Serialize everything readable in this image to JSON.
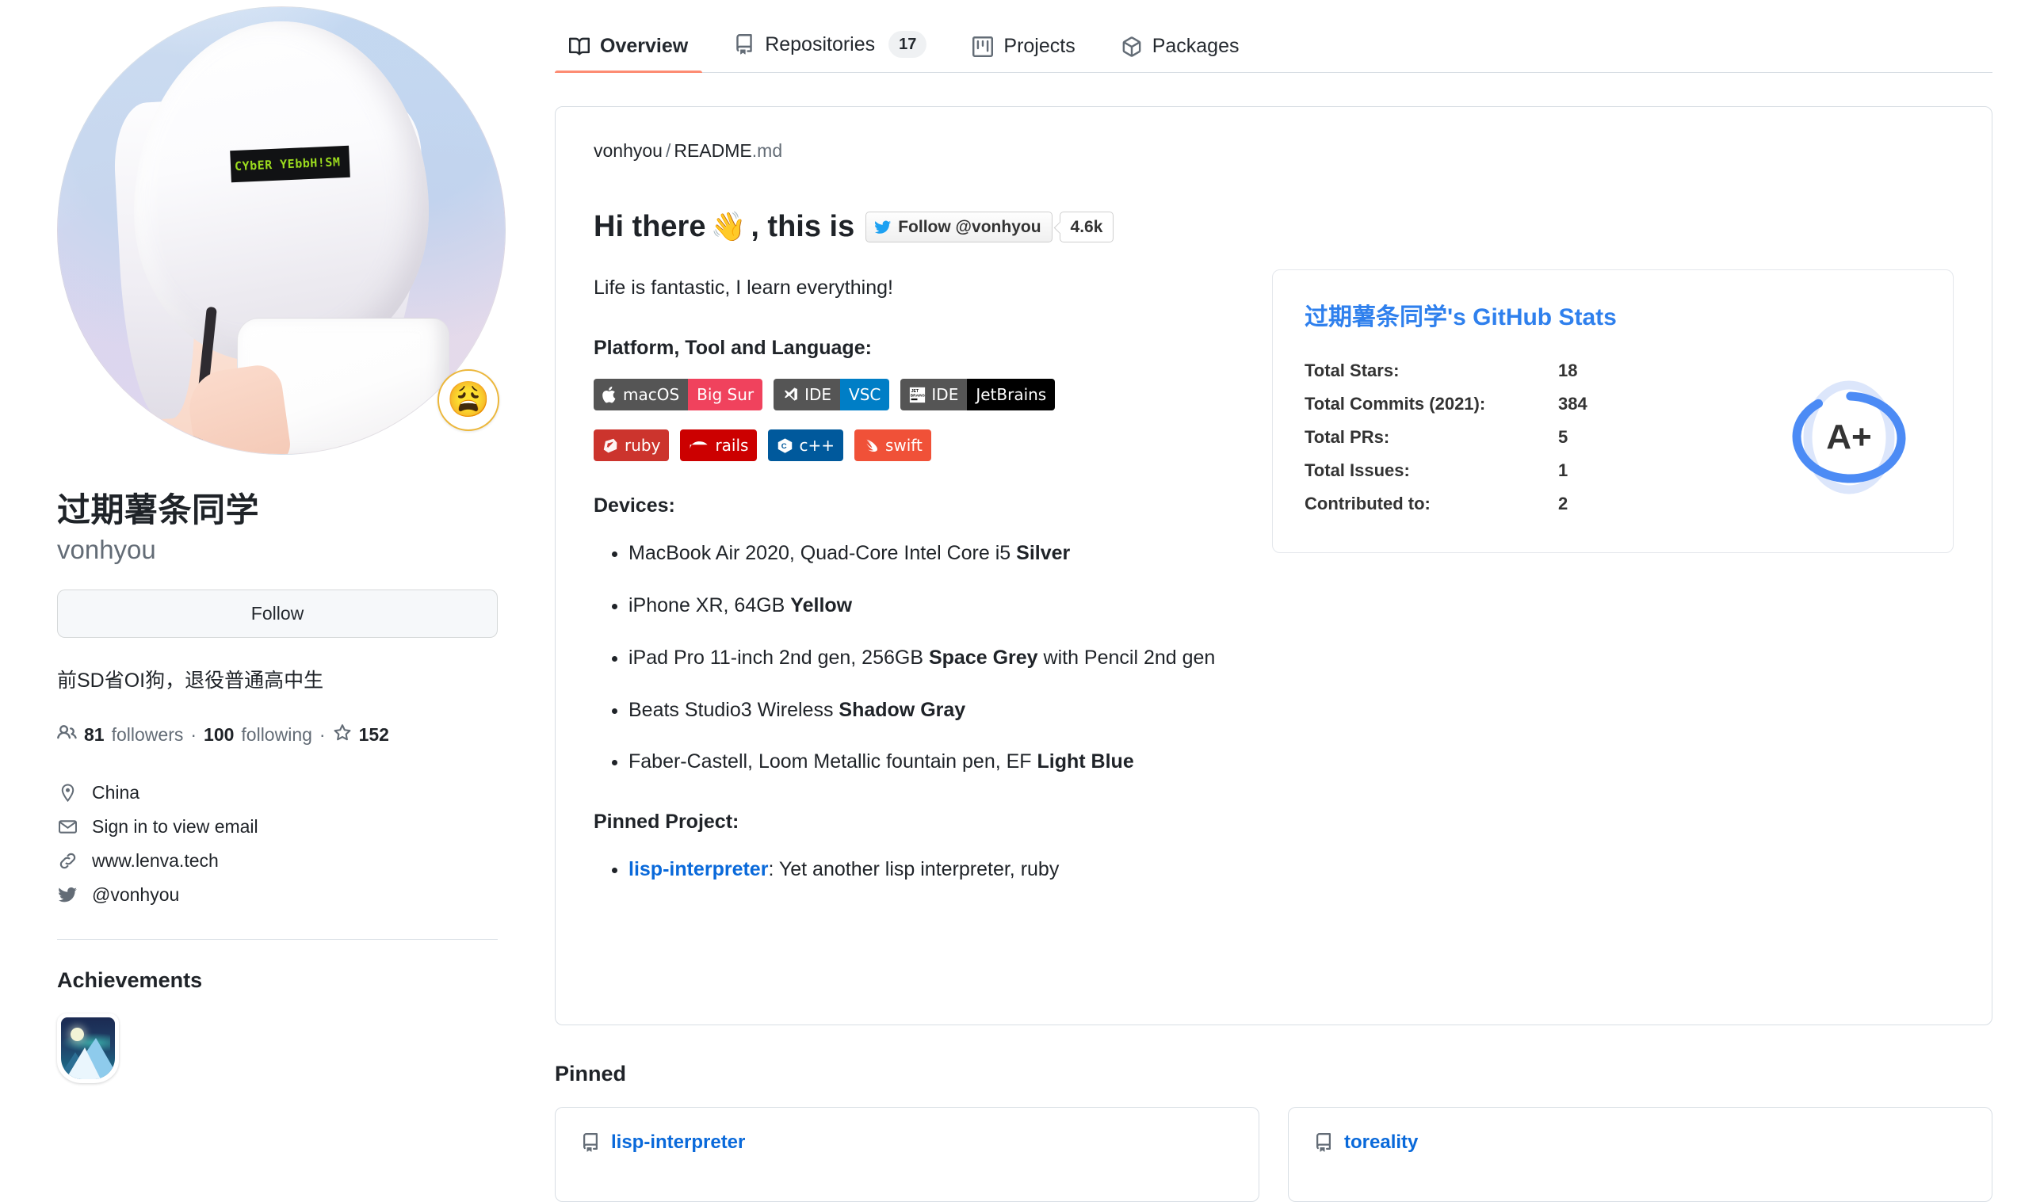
{
  "tabs": [
    {
      "label": "Overview",
      "icon": "book-icon",
      "active": true,
      "count": null
    },
    {
      "label": "Repositories",
      "icon": "repo-icon",
      "active": false,
      "count": "17"
    },
    {
      "label": "Projects",
      "icon": "project-icon",
      "active": false,
      "count": null
    },
    {
      "label": "Packages",
      "icon": "package-icon",
      "active": false,
      "count": null
    }
  ],
  "profile": {
    "display_name": "过期薯条同学",
    "login": "vonhyou",
    "follow_label": "Follow",
    "bio": "前SD省OI狗，退役普通高中生",
    "status_emoji": "😩",
    "avatar_censor_text": "CYbER YEbbH!SM",
    "stats": {
      "followers_count": "81",
      "followers_label": "followers",
      "following_count": "100",
      "following_label": "following",
      "stars_count": "152",
      "separator": "·"
    },
    "meta": [
      {
        "icon": "location-icon",
        "text": "China"
      },
      {
        "icon": "mail-icon",
        "text": "Sign in to view email"
      },
      {
        "icon": "link-icon",
        "text": "www.lenva.tech"
      },
      {
        "icon": "twitter-icon",
        "text": "@vonhyou"
      }
    ],
    "achievements_title": "Achievements",
    "achievement_badge_name": "arctic-code-vault-badge"
  },
  "readme": {
    "breadcrumb_owner": "vonhyou",
    "breadcrumb_slash": "/",
    "breadcrumb_file": "README",
    "breadcrumb_ext": ".md",
    "heading_pre": "Hi there",
    "heading_wave": "👋",
    "heading_post": ", this is",
    "twitter_follow_label": "Follow @vonhyou",
    "twitter_count": "4.6k",
    "intro": "Life is fantastic, I learn everything!",
    "platform_heading": "Platform, Tool and Language:",
    "platform_badges": [
      {
        "left": "macOS",
        "right": "Big Sur",
        "icon": "apple-icon",
        "left_color": "#555555",
        "right_color": "#F0425D"
      },
      {
        "left": "IDE",
        "right": "VSC",
        "icon": "vscode-icon",
        "left_color": "#555555",
        "right_color": "#007EC6"
      },
      {
        "left": "IDE",
        "right": "JetBrains",
        "icon": "jetbrains-icon",
        "left_color": "#555555",
        "right_color": "#000000"
      }
    ],
    "language_badges": [
      {
        "label": "ruby",
        "icon": "ruby-icon",
        "color": "#CC342D"
      },
      {
        "label": "rails",
        "icon": "rails-icon",
        "color": "#CC0000"
      },
      {
        "label": "c++",
        "icon": "cpp-icon",
        "color": "#00599C"
      },
      {
        "label": "swift",
        "icon": "swift-icon",
        "color": "#F05138"
      }
    ],
    "devices_heading": "Devices:",
    "devices": [
      {
        "text": "MacBook Air 2020, Quad-Core Intel Core i5 ",
        "bold": "Silver",
        "after": ""
      },
      {
        "text": "iPhone XR, 64GB ",
        "bold": "Yellow",
        "after": ""
      },
      {
        "text": "iPad Pro 11-inch 2nd gen, 256GB ",
        "bold": "Space Grey",
        "after": " with Pencil 2nd gen"
      },
      {
        "text": "Beats Studio3 Wireless ",
        "bold": "Shadow Gray",
        "after": ""
      },
      {
        "text": "Faber-Castell, Loom Metallic fountain pen, EF ",
        "bold": "Light Blue",
        "after": ""
      }
    ],
    "pinned_project_heading": "Pinned Project:",
    "pinned_project_link": "lisp-interpreter",
    "pinned_project_desc": ": Yet another lisp interpreter, ruby"
  },
  "github_stats": {
    "title": "过期薯条同学's GitHub Stats",
    "rank": "A+",
    "rank_accent": "#4c8bf5",
    "rank_track": "#dce6fb",
    "rows": [
      {
        "label": "Total Stars:",
        "value": "18"
      },
      {
        "label": "Total Commits (2021):",
        "value": "384"
      },
      {
        "label": "Total PRs:",
        "value": "5"
      },
      {
        "label": "Total Issues:",
        "value": "1"
      },
      {
        "label": "Contributed to:",
        "value": "2"
      }
    ]
  },
  "pinned": {
    "title": "Pinned",
    "repos": [
      {
        "name": "lisp-interpreter"
      },
      {
        "name": "toreality"
      }
    ]
  }
}
